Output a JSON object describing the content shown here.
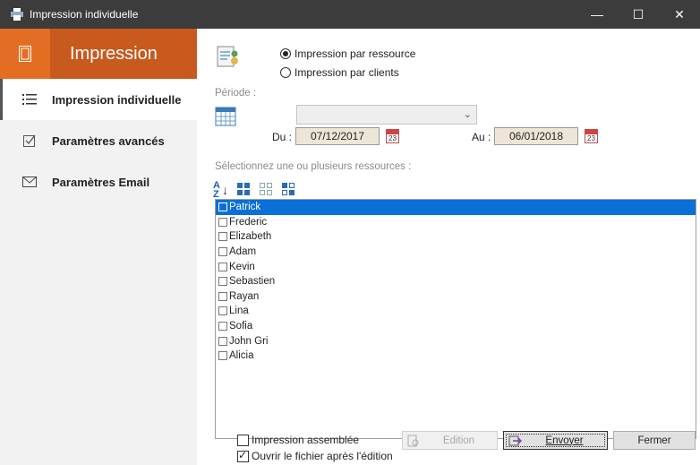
{
  "window": {
    "title": "Impression individuelle"
  },
  "sidebar": {
    "header": "Impression",
    "items": [
      {
        "label": "Impression individuelle",
        "icon": "list-icon"
      },
      {
        "label": "Paramètres avancés",
        "icon": "checkbox-icon"
      },
      {
        "label": "Paramètres Email",
        "icon": "envelope-icon"
      }
    ]
  },
  "mode": {
    "options": [
      "Impression par ressource",
      "Impression par clients"
    ],
    "selected": "Impression par ressource"
  },
  "periode": {
    "label": "Période :",
    "select_value": "",
    "du_label": "Du :",
    "du_value": "07/12/2017",
    "au_label": "Au :",
    "au_value": "06/01/2018",
    "calendar_day": "23"
  },
  "resources": {
    "label": "Sélectionnez une ou plusieurs ressources :",
    "items": [
      {
        "name": "Patrick",
        "checked": false,
        "selected": true
      },
      {
        "name": "Frederic",
        "checked": false,
        "selected": false
      },
      {
        "name": "Elizabeth",
        "checked": false,
        "selected": false
      },
      {
        "name": "Adam",
        "checked": false,
        "selected": false
      },
      {
        "name": "Kevin",
        "checked": false,
        "selected": false
      },
      {
        "name": "Sebastien",
        "checked": false,
        "selected": false
      },
      {
        "name": "Rayan",
        "checked": false,
        "selected": false
      },
      {
        "name": "Lina",
        "checked": false,
        "selected": false
      },
      {
        "name": "Sofia",
        "checked": false,
        "selected": false
      },
      {
        "name": "John Gri",
        "checked": false,
        "selected": false
      },
      {
        "name": "Alicia",
        "checked": false,
        "selected": false
      }
    ]
  },
  "footer": {
    "assembled_label": "Impression assemblée",
    "assembled_checked": false,
    "open_label": "Ouvrir le fichier après l'édition",
    "open_checked": true,
    "edition_label": "Edition",
    "envoyer_label": "Envoyer",
    "fermer_label": "Fermer"
  },
  "colors": {
    "accent": "#c85a1e",
    "accent_light": "#e36d22",
    "selection": "#0a6fd6",
    "titlebar": "#3c3c3c"
  }
}
